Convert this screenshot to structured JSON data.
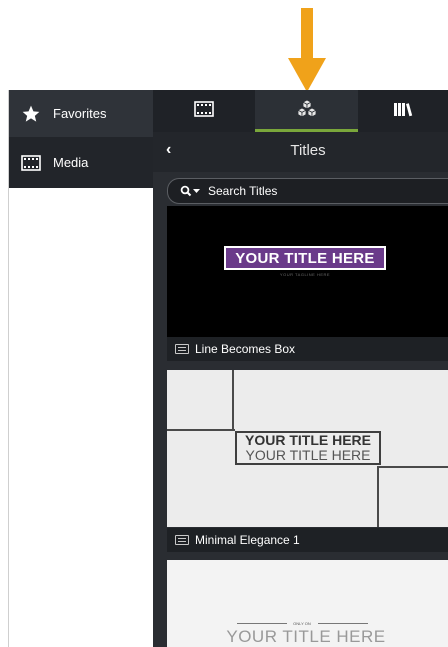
{
  "sidebar": {
    "items": [
      {
        "label": "Favorites",
        "icon": "star-icon"
      },
      {
        "label": "Media",
        "icon": "film-icon"
      }
    ]
  },
  "toolbar": {
    "tabs": [
      {
        "name": "media",
        "icon": "film-icon"
      },
      {
        "name": "annotations",
        "icon": "cubes-icon",
        "selected": true
      },
      {
        "name": "library",
        "icon": "books-icon"
      }
    ]
  },
  "panel": {
    "title": "Titles",
    "search_placeholder": "Search Titles"
  },
  "titles": [
    {
      "name": "Line Becomes Box",
      "preview_text": "YOUR TITLE HERE",
      "preview_subtext": "YOUR TAGLINE HERE"
    },
    {
      "name": "Minimal Elegance 1",
      "preview_text": "YOUR TITLE HERE",
      "preview_subtext": "YOUR TITLE HERE"
    },
    {
      "name": "",
      "preview_small": "ONLY ON",
      "preview_text": "YOUR TITLE HERE"
    }
  ],
  "colors": {
    "arrow": "#f0a21a",
    "accent_underline": "#7aa73b",
    "title_box": "#6a3a8a"
  }
}
